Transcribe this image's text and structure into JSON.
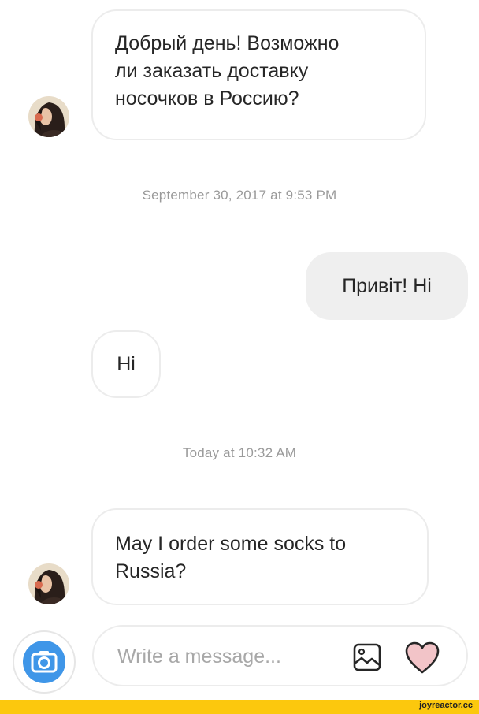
{
  "conversation": {
    "messages": [
      {
        "direction": "incoming",
        "lines": [
          "Добрый день! Возможно",
          "ли заказать доставку",
          "носочков в Россию?"
        ]
      },
      {
        "direction": "outgoing",
        "lines": [
          "Привіт! Hi"
        ]
      },
      {
        "direction": "incoming",
        "lines": [
          "Hi"
        ]
      },
      {
        "direction": "incoming",
        "lines": [
          "May I order some socks to",
          "Russia?"
        ]
      }
    ],
    "timestamps": [
      "September 30, 2017 at 9:53 PM",
      "Today at 10:32 AM"
    ]
  },
  "composer": {
    "placeholder": "Write a message...",
    "icons": {
      "camera": "camera-icon",
      "gallery": "image-icon",
      "like": "heart-icon"
    }
  },
  "watermark": {
    "text": "joyreactor.cc"
  },
  "colors": {
    "outgoing_bubble": "#efefef",
    "incoming_border": "#ececec",
    "timestamp": "#9a9a9a",
    "camera_blue": "#3897f0",
    "heart_fill": "#f2c4c8",
    "footer_bar": "#fcc80d"
  }
}
